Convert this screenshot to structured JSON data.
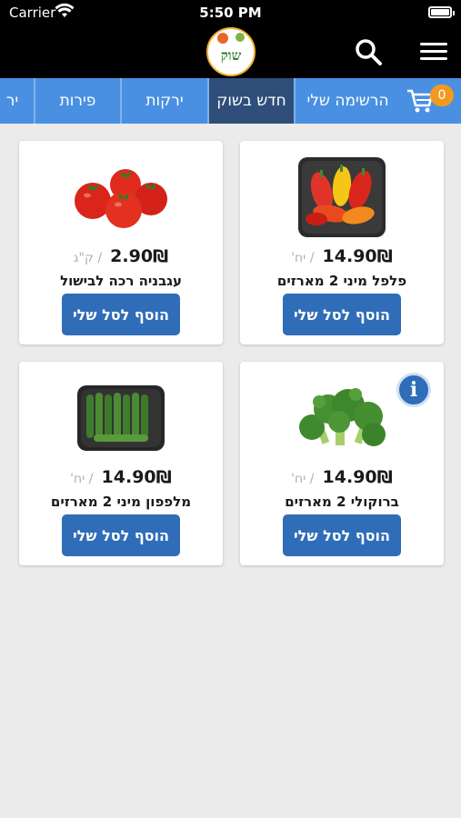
{
  "status_bar": {
    "carrier": "Carrier",
    "time": "5:50 PM"
  },
  "header": {
    "logo_text": "שוק"
  },
  "cart": {
    "count": "0"
  },
  "tabs": [
    {
      "label": "הרשימה שלי",
      "active": false
    },
    {
      "label": "חדש בשוק",
      "active": true
    },
    {
      "label": "ירקות",
      "active": false
    },
    {
      "label": "פירות",
      "active": false
    },
    {
      "label": "יר",
      "active": false
    }
  ],
  "products": [
    {
      "name": "פלפל מיני 2 מארזים",
      "price": "14.90₪",
      "unit": "/ יח'",
      "add_label": "הוסף לסל שלי",
      "image": "mini-peppers"
    },
    {
      "name": "עגבניה רכה לבישול",
      "price": "2.90₪",
      "unit": "/ ק\"ג",
      "add_label": "הוסף לסל שלי",
      "image": "tomatoes"
    },
    {
      "name": "ברוקולי 2 מארזים",
      "price": "14.90₪",
      "unit": "/ יח'",
      "add_label": "הוסף לסל שלי",
      "image": "broccoli"
    },
    {
      "name": "מלפפון מיני 2 מארזים",
      "price": "14.90₪",
      "unit": "/ יח'",
      "add_label": "הוסף לסל שלי",
      "image": "mini-cucumbers"
    }
  ],
  "info_icon": "i"
}
